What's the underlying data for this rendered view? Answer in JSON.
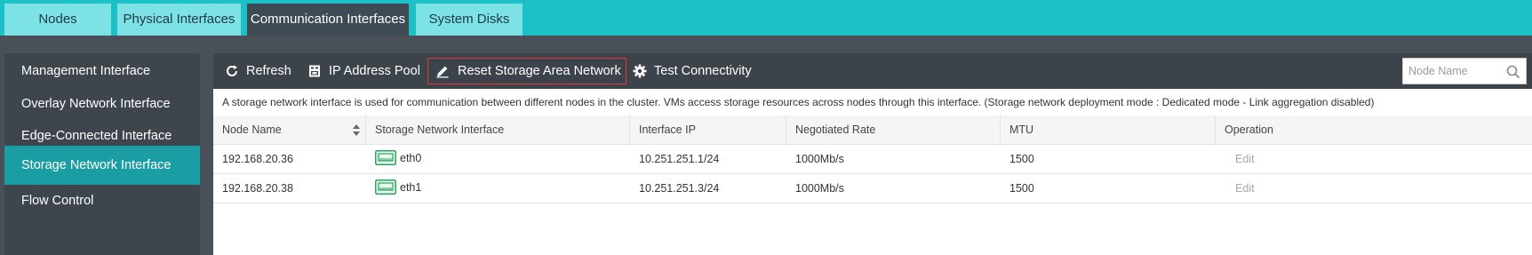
{
  "top_tabs": [
    {
      "label": "Nodes",
      "active": false
    },
    {
      "label": "Physical Interfaces",
      "active": false
    },
    {
      "label": "Communication Interfaces",
      "active": true
    },
    {
      "label": "System Disks",
      "active": false
    }
  ],
  "sidebar": {
    "items": [
      {
        "label": "Management Interface",
        "active": false
      },
      {
        "label": "Overlay Network Interface",
        "active": false
      },
      {
        "label": "Edge-Connected Interface",
        "active": false
      },
      {
        "label": "Storage Network Interface",
        "active": true
      },
      {
        "label": "Flow Control",
        "active": false
      }
    ]
  },
  "toolbar": {
    "refresh_label": "Refresh",
    "ip_pool_label": "IP Address Pool",
    "reset_label": "Reset Storage Area Network",
    "test_label": "Test Connectivity",
    "search_placeholder": "Node Name",
    "search_value": ""
  },
  "description": "A storage network interface is used for communication between different nodes in the cluster. VMs access storage resources across nodes through this interface. (Storage network deployment mode : Dedicated mode - Link aggregation disabled)",
  "table": {
    "headers": [
      "Node Name",
      "Storage Network Interface",
      "Interface IP",
      "Negotiated Rate",
      "MTU",
      "Operation"
    ],
    "rows": [
      {
        "node": "192.168.20.36",
        "iface": "eth0",
        "ip": "10.251.251.1/24",
        "rate": "1000Mb/s",
        "mtu": "1500",
        "op": "Edit"
      },
      {
        "node": "192.168.20.38",
        "iface": "eth1",
        "ip": "10.251.251.3/24",
        "rate": "1000Mb/s",
        "mtu": "1500",
        "op": "Edit"
      }
    ]
  },
  "colors": {
    "topbar": "#1cc0c6",
    "tab_inactive": "#7de2e5",
    "tab_active": "#3e4a54",
    "sidebar_active": "#1a9ea4",
    "highlight_border": "#e0393b",
    "nic_icon": "#2aa360"
  },
  "icons": {
    "refresh": "refresh-icon",
    "ip_pool": "ip-pool-icon",
    "reset": "edit-pencil-icon",
    "test": "gear-icon",
    "search": "search-icon",
    "sort": "sort-icon",
    "nic": "network-port-icon"
  }
}
